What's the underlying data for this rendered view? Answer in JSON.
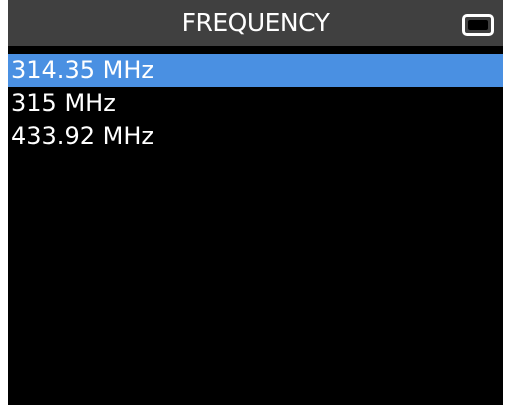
{
  "header": {
    "title": "FREQUENCY",
    "battery_icon": "battery-icon"
  },
  "frequency_list": {
    "selected_index": 0,
    "items": [
      {
        "label": "314.35 MHz"
      },
      {
        "label": "315 MHz"
      },
      {
        "label": "433.92 MHz"
      }
    ]
  },
  "colors": {
    "header_background": "#404040",
    "screen_background": "#000000",
    "selection_highlight": "#4a90e2",
    "text": "#ffffff"
  }
}
